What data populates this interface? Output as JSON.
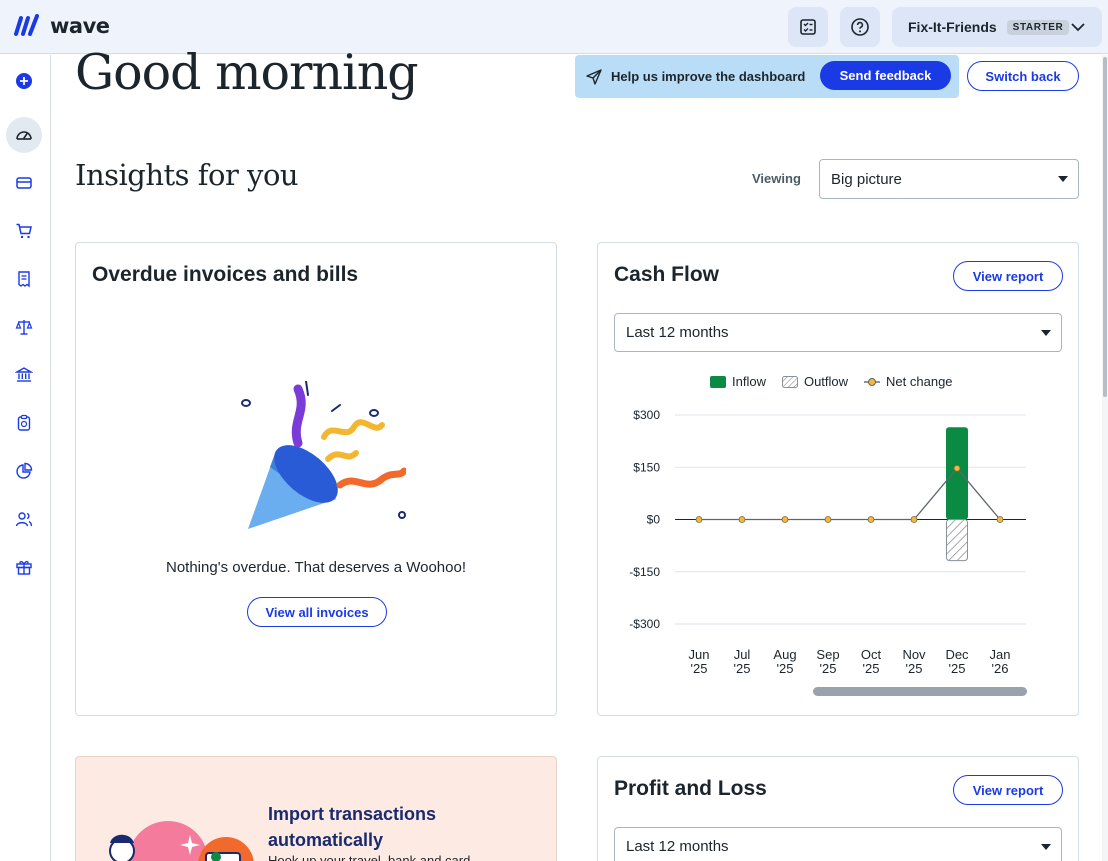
{
  "app": {
    "logo_text": "wave"
  },
  "topbar": {
    "business_name": "Fix-It-Friends",
    "plan_badge": "STARTER"
  },
  "sidebar": {
    "items": [
      {
        "icon": "plus-circle-icon"
      },
      {
        "icon": "dashboard-gauge-icon",
        "active": true
      },
      {
        "icon": "credit-card-icon"
      },
      {
        "icon": "cart-icon"
      },
      {
        "icon": "receipt-icon"
      },
      {
        "icon": "scales-icon"
      },
      {
        "icon": "bank-icon"
      },
      {
        "icon": "clipboard-dollar-icon"
      },
      {
        "icon": "pie-chart-icon"
      },
      {
        "icon": "people-icon"
      },
      {
        "icon": "gift-icon"
      }
    ]
  },
  "main": {
    "greeting": "Good morning",
    "feedback": {
      "text": "Help us improve the dashboard",
      "button": "Send feedback"
    },
    "switch_back": "Switch back",
    "insights_title": "Insights for you",
    "viewing": {
      "label": "Viewing",
      "value": "Big picture"
    }
  },
  "overdue_card": {
    "title": "Overdue invoices and bills",
    "message": "Nothing's overdue. That deserves a Woohoo!",
    "button": "View all invoices"
  },
  "cashflow_card": {
    "title": "Cash Flow",
    "button": "View report",
    "period": "Last 12 months",
    "legend": {
      "inflow": "Inflow",
      "outflow": "Outflow",
      "net": "Net change"
    }
  },
  "chart_data": {
    "type": "bar",
    "categories": [
      "Jun '25",
      "Jul '25",
      "Aug '25",
      "Sep '25",
      "Oct '25",
      "Nov '25",
      "Dec '25",
      "Jan '26"
    ],
    "x_tick_lines": [
      [
        "Jun",
        "'25"
      ],
      [
        "Jul",
        "'25"
      ],
      [
        "Aug",
        "'25"
      ],
      [
        "Sep",
        "'25"
      ],
      [
        "Oct",
        "'25"
      ],
      [
        "Nov",
        "'25"
      ],
      [
        "Dec",
        "'25"
      ],
      [
        "Jan",
        "'26"
      ]
    ],
    "series": [
      {
        "name": "Inflow",
        "values": [
          0,
          0,
          0,
          0,
          0,
          0,
          265,
          0
        ]
      },
      {
        "name": "Outflow",
        "values": [
          0,
          0,
          0,
          0,
          0,
          0,
          -118,
          0
        ]
      },
      {
        "name": "Net change",
        "values": [
          0,
          0,
          0,
          0,
          0,
          0,
          147,
          0
        ]
      }
    ],
    "y_ticks": [
      "$300",
      "$150",
      "$0",
      "-$150",
      "-$300"
    ],
    "ylim": [
      -300,
      300
    ],
    "grid": true,
    "legend_position": "top",
    "colors": {
      "inflow": "#0a8a43",
      "outflow_stroke": "#8b9198",
      "net_line": "#5c6670",
      "net_dot": "#f5b73b"
    }
  },
  "import_card": {
    "title": "Import transactions automatically",
    "subtitle": "Hook up your travel, bank and card"
  },
  "pnl_card": {
    "title": "Profit and Loss",
    "button": "View report",
    "period": "Last 12 months"
  }
}
